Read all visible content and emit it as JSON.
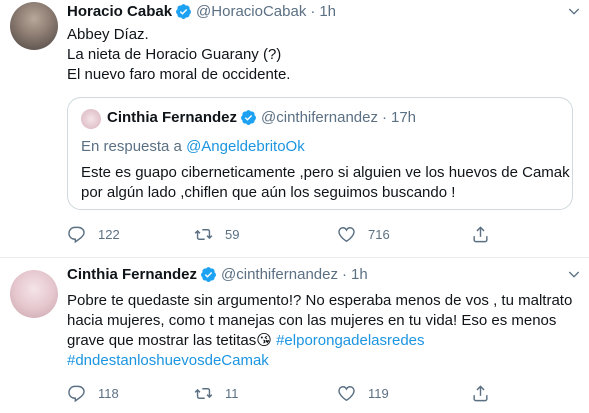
{
  "tweet1": {
    "name": "Horacio Cabak",
    "handle": "@HoracioCabak",
    "dot": "·",
    "time": "1h",
    "lines": [
      "Abbey Díaz.",
      "La nieta de Horacio Guarany (?)",
      "El nuevo faro moral de occidente."
    ],
    "quote": {
      "name": "Cinthia Fernandez",
      "handle": "@cinthifernandez",
      "dot": "·",
      "time": "17h",
      "reply_prefix": "En respuesta a",
      "reply_to": "@AngeldebritoOk",
      "lines": [
        "Este es guapo ciberneticamente ,pero si alguien ve los huevos de Camak",
        "por algún lado ,chiflen que aún los seguimos buscando !"
      ]
    },
    "actions": {
      "replies": "122",
      "retweets": "59",
      "likes": "716"
    }
  },
  "tweet2": {
    "name": "Cinthia Fernandez",
    "handle": "@cinthifernandez",
    "dot": "·",
    "time": "1h",
    "line1": "Pobre te quedaste sin argumento!? No esperaba menos de vos , tu maltrato",
    "line2": "hacia mujeres, como t manejas con las mujeres en tu vida! Eso es menos",
    "line3_text": "grave que mostrar las tetitas",
    "line3_emoji": "😘",
    "hashtag1": "#elporongadelasredes",
    "hashtag2": "#dndestanloshuevosdeCamak",
    "actions": {
      "replies": "118",
      "retweets": "11",
      "likes": "119"
    }
  },
  "icons": [
    "verified-badge-icon",
    "chevron-down-icon",
    "reply-icon",
    "retweet-icon",
    "like-icon",
    "share-icon"
  ],
  "colors": {
    "link": "#1b95e0",
    "secondary": "#5b7083",
    "verified": "#1da1f2"
  }
}
